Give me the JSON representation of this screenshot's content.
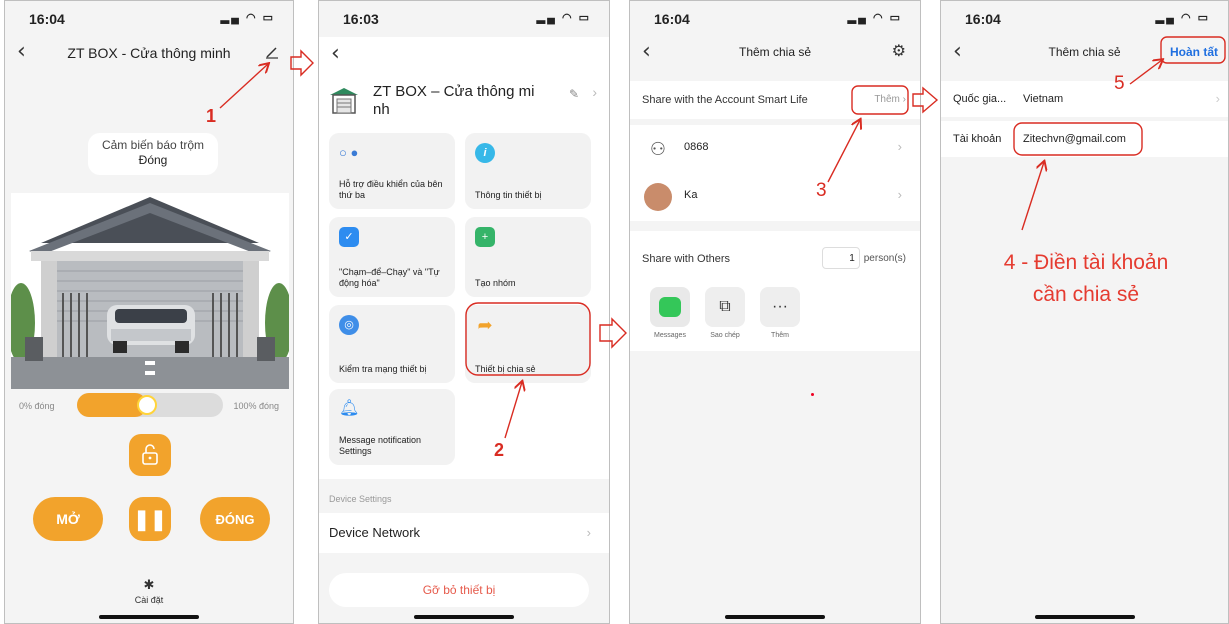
{
  "p1": {
    "time": "16:04",
    "title": "ZT BOX - Cửa thông minh",
    "sensor_label": "Cảm biến báo trộm",
    "sensor_state": "Đóng",
    "min_label": "0% đóng",
    "max_label": "100% đóng",
    "closed_fraction": 0.48,
    "open_label": "MỞ",
    "close_label": "ĐÓNG",
    "settings_label": "Cài đặt"
  },
  "p2": {
    "time": "16:03",
    "device_name": "ZT BOX – Cửa thông mi nh",
    "tiles": [
      {
        "label": "Hỗ trợ điều khiển của bên thứ ba",
        "icon": "assistant-icon"
      },
      {
        "label": "Thông tin thiết bị",
        "icon": "info-icon"
      },
      {
        "label": "\"Chạm–để–Chạy\" và \"Tự động hóa\"",
        "icon": "shield-check-icon"
      },
      {
        "label": "Tạo nhóm",
        "icon": "add-group-icon"
      },
      {
        "label": "Kiểm tra mạng thiết bị",
        "icon": "network-icon"
      },
      {
        "label": "Thiết bị chia sẻ",
        "icon": "share-icon"
      },
      {
        "label": "Message notification Settings",
        "icon": "bell-icon"
      }
    ],
    "section_label": "Device Settings",
    "network_label": "Device Network",
    "remove_label": "Gỡ bỏ thiết bị"
  },
  "p3": {
    "time": "16:04",
    "title": "Thêm chia sẻ",
    "share_account_label": "Share with the Account Smart Life",
    "add_label": "Thêm",
    "accounts": [
      {
        "name": "0868",
        "avatar": "person-icon"
      },
      {
        "name": "Ka",
        "avatar": "photo-avatar"
      }
    ],
    "others_label": "Share with Others",
    "person_count": "1",
    "person_unit": "person(s)",
    "options": [
      {
        "label": "Messages",
        "icon": "messages-icon"
      },
      {
        "label": "Sao chép",
        "icon": "copy-icon"
      },
      {
        "label": "Thêm",
        "icon": "more-icon"
      }
    ]
  },
  "p4": {
    "time": "16:04",
    "title": "Thêm chia sẻ",
    "done_label": "Hoàn tất",
    "country_label": "Quốc gia...",
    "country_value": "Vietnam",
    "account_label": "Tài khoản",
    "account_value": "Zitechvn@gmail.com"
  },
  "annotations": {
    "step1": "1",
    "step2": "2",
    "step3": "3",
    "step4_line1": "4 - Điền tài khoản",
    "step4_line2": "cần chia sẻ",
    "step5": "5",
    "accent_color": "#f2a32c",
    "annotation_color": "#e53b30"
  }
}
